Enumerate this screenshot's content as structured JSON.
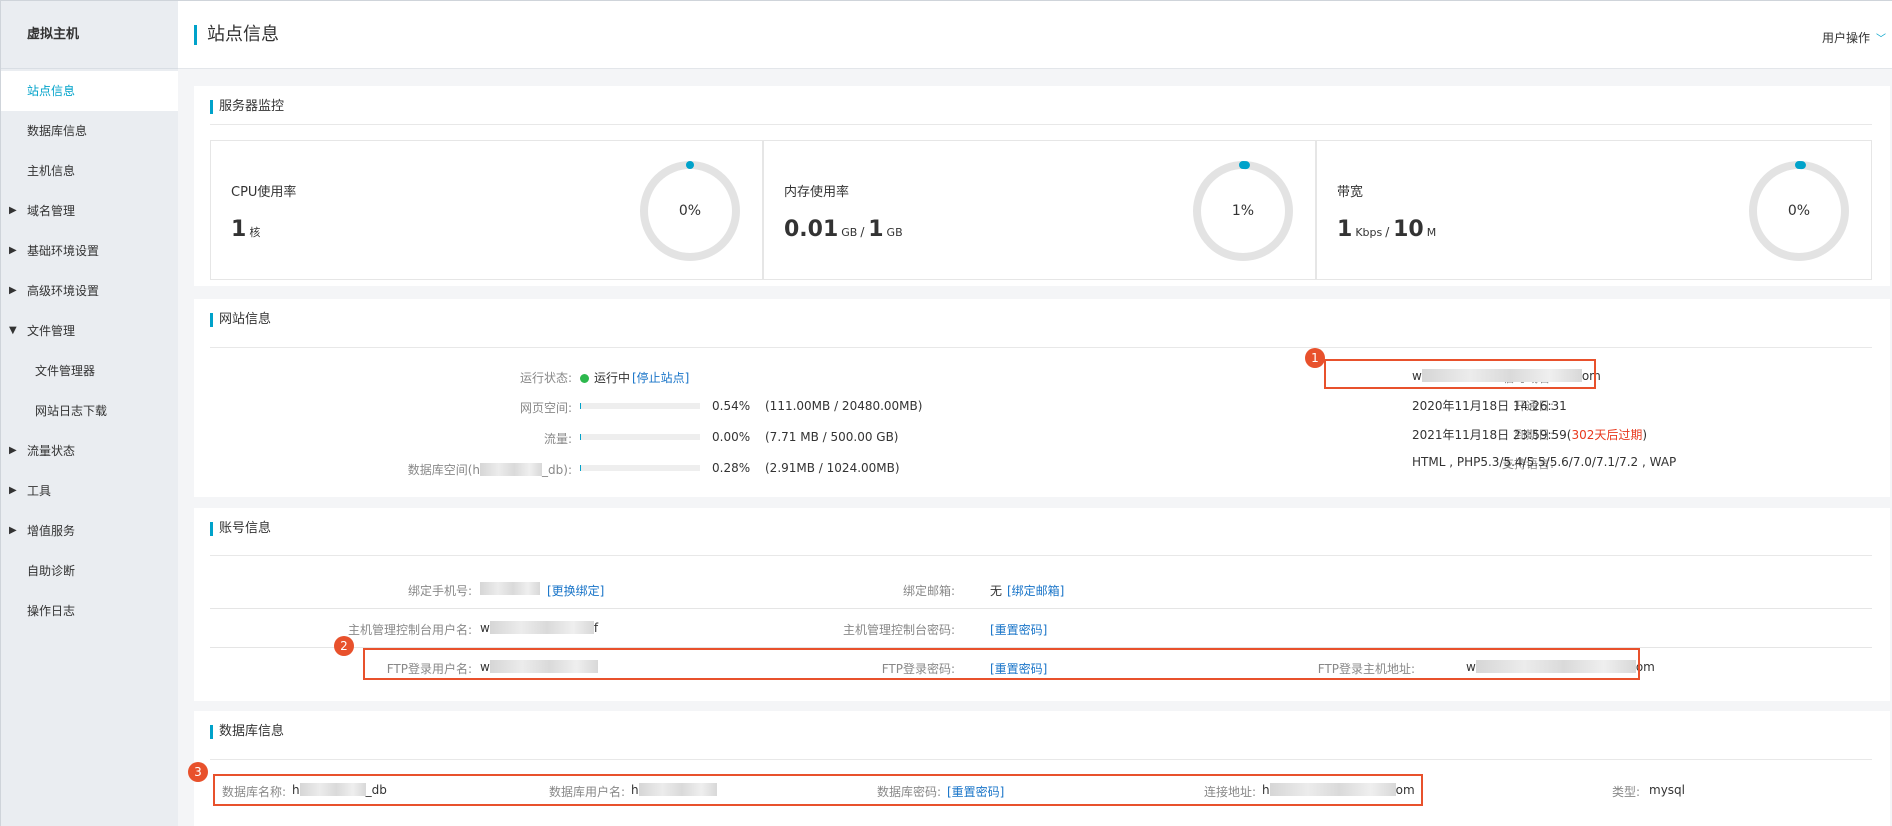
{
  "sidebar": {
    "title": "虚拟主机",
    "items": [
      {
        "label": "站点信息"
      },
      {
        "label": "数据库信息"
      },
      {
        "label": "主机信息"
      },
      {
        "label": "域名管理"
      },
      {
        "label": "基础环境设置"
      },
      {
        "label": "高级环境设置"
      },
      {
        "label": "文件管理"
      },
      {
        "label": "文件管理器"
      },
      {
        "label": "网站日志下载"
      },
      {
        "label": "流量状态"
      },
      {
        "label": "工具"
      },
      {
        "label": "增值服务"
      },
      {
        "label": "自助诊断"
      },
      {
        "label": "操作日志"
      }
    ]
  },
  "header": {
    "title": "站点信息",
    "user_menu": "用户操作"
  },
  "monitor": {
    "title": "服务器监控",
    "cpu": {
      "label": "CPU使用率",
      "value": "1",
      "unit": "核",
      "percent": "0%",
      "ratio": 0
    },
    "mem": {
      "label": "内存使用率",
      "used": "0.01",
      "used_unit": "GB",
      "sep": "/",
      "total": "1",
      "total_unit": "GB",
      "percent": "1%",
      "ratio": 0.01
    },
    "bw": {
      "label": "带宽",
      "used": "1",
      "used_unit": "Kbps",
      "sep": "/",
      "total": "10",
      "total_unit": "M",
      "percent": "0%",
      "ratio": 0.01
    },
    "accent": "#00a2ca"
  },
  "site": {
    "title": "网站信息",
    "status_label": "运行状态:",
    "status_value": "运行中",
    "stop_link": "[停止站点]",
    "web_space_label": "网页空间:",
    "web_space_pct": "0.54%",
    "web_space_detail": "(111.00MB / 20480.00MB)",
    "traffic_label": "流量:",
    "traffic_pct": "0.00%",
    "traffic_detail": "(7.71 MB / 500.00 GB)",
    "db_space_label_a": "数据库空间(h",
    "db_space_label_b": "_db):",
    "db_space_pct": "0.28%",
    "db_space_detail": "(2.91MB / 1024.00MB)",
    "temp_domain_label": "临时域名:",
    "temp_domain_a": "w",
    "temp_domain_b": "om",
    "open_label": "开通日:",
    "open_value": "2020年11月18日 14:26:31",
    "expire_label": "到期日:",
    "expire_value": "2021年11月18日 23:59:59(",
    "expire_warn": "302天后过期",
    "expire_close": ")",
    "lang_label": "支持语言:",
    "lang_value": "HTML , PHP5.3/5.4/5.5/5.6/7.0/7.1/7.2 , WAP"
  },
  "account": {
    "title": "账号信息",
    "phone_label": "绑定手机号:",
    "phone_link": "[更换绑定]",
    "email_label": "绑定邮箱:",
    "email_value": "无",
    "email_link": "[绑定邮箱]",
    "ctrl_user_label": "主机管理控制台用户名:",
    "ctrl_user_a": "w",
    "ctrl_user_b": "f",
    "ctrl_pwd_label": "主机管理控制台密码:",
    "ctrl_pwd_link": "[重置密码]",
    "ftp_user_label": "FTP登录用户名:",
    "ftp_user_a": "w",
    "ftp_pwd_label": "FTP登录密码:",
    "ftp_pwd_link": "[重置密码]",
    "ftp_host_label": "FTP登录主机地址:",
    "ftp_host_a": "w",
    "ftp_host_b": "om"
  },
  "database": {
    "title": "数据库信息",
    "name_label": "数据库名称:",
    "name_a": "h",
    "name_b": "_db",
    "user_label": "数据库用户名:",
    "user_a": "h",
    "pwd_label": "数据库密码:",
    "pwd_link": "[重置密码]",
    "host_label": "连接地址:",
    "host_a": "h",
    "host_b": "om",
    "type_label": "类型:",
    "type_value": "mysql"
  },
  "annotations": {
    "badge1": "1",
    "badge2": "2",
    "badge3": "3",
    "color": "#e8512c"
  }
}
